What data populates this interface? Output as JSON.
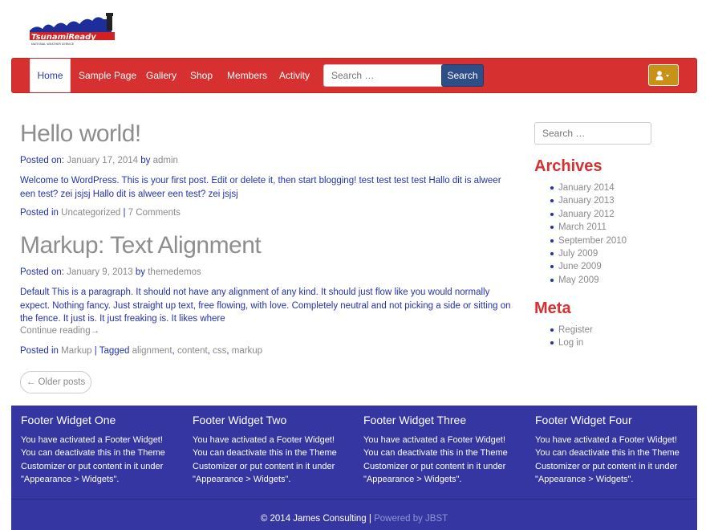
{
  "brand": {
    "logo_text": "TsunamiReady",
    "logo_subtext": "NATIONAL WEATHER SERVICE"
  },
  "nav": {
    "items": [
      {
        "label": "Home"
      },
      {
        "label": "Sample Page"
      },
      {
        "label": "Gallery"
      },
      {
        "label": "Shop"
      },
      {
        "label": "Members"
      },
      {
        "label": "Activity"
      }
    ],
    "search_placeholder": "Search …",
    "search_button": "Search",
    "user_menu_icon": "user-icon"
  },
  "posts": [
    {
      "title": "Hello world!",
      "posted_on_label": "Posted on:",
      "date": "January 17, 2014",
      "by_label": "by",
      "author": "admin",
      "excerpt": "Welcome to WordPress. This is your first post. Edit or delete it, then start blogging! test test test test Hallo dit is alweer een test? zei jsjsj Hallo dit is alweer een test? zei jsjsj",
      "posted_in_label": "Posted in",
      "category": "Uncategorized",
      "comments": "7 Comments"
    },
    {
      "title": "Markup: Text Alignment",
      "posted_on_label": "Posted on:",
      "date": "January 9, 2013",
      "by_label": "by",
      "author": "themedemos",
      "excerpt": "Default This is a paragraph. It should not have any alignment of any kind. It should just flow like you would normally expect. Nothing fancy. Just straight up text, free flowing, with love. Completely neutral and not picking a side or sitting on the fence. It just is. It just freaking is. It likes where",
      "continue_label": "Continue reading→",
      "posted_in_label": "Posted in",
      "category": "Markup",
      "tagged_label": "Tagged",
      "tags": [
        "alignment",
        "content",
        "css",
        "markup"
      ]
    }
  ],
  "older_posts_label": "← Older posts",
  "sidebar": {
    "search_placeholder": "Search …",
    "archives_heading": "Archives",
    "archives": [
      "January 2014",
      "January 2013",
      "January 2012",
      "March 2011",
      "September 2010",
      "July 2009",
      "June 2009",
      "May 2009"
    ],
    "meta_heading": "Meta",
    "meta_links": [
      "Register",
      "Log in"
    ]
  },
  "footer": {
    "widgets": [
      {
        "title": "Footer Widget One",
        "text": "You have activated a Footer Widget! You can deactivate this in the Theme Customizer or put content in it under \"Appearance > Widgets\"."
      },
      {
        "title": "Footer Widget Two",
        "text": "You have activated a Footer Widget! You can deactivate this in the Theme Customizer or put content in it under \"Appearance > Widgets\"."
      },
      {
        "title": "Footer Widget Three",
        "text": "You have activated a Footer Widget! You can deactivate this in the Theme Customizer or put content in it under \"Appearance > Widgets\"."
      },
      {
        "title": "Footer Widget Four",
        "text": "You have activated a Footer Widget! You can deactivate this in the Theme Customizer or put content in it under \"Appearance > Widgets\"."
      }
    ],
    "copyright": "© 2014 James Consulting",
    "separator": "|",
    "powered_by": "Powered by JBST"
  },
  "colors": {
    "navbar": "#d63030",
    "search_button": "#2d4e86",
    "user_button": "#c89216",
    "footer": "#3636a2",
    "link": "#2233aa",
    "heading_accent": "#d63030"
  }
}
